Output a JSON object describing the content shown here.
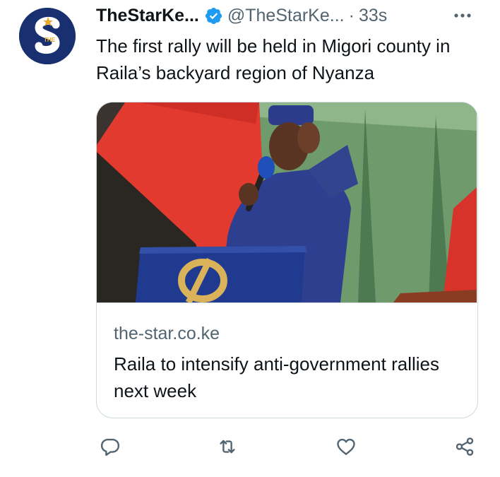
{
  "tweet": {
    "display_name": "TheStarKe...",
    "handle": "@TheStarKe...",
    "separator": "·",
    "timestamp": "33s",
    "text": "The first rally will be held in Migori county in Raila’s backyard region of Nyanza",
    "avatar_logo_text": "THE"
  },
  "card": {
    "domain": "the-star.co.ke",
    "title": "Raila to intensify anti-government rallies next week"
  },
  "icons": {
    "verified": "verified-badge-icon",
    "more": "more-options-icon",
    "reply": "reply-icon",
    "retweet": "retweet-icon",
    "like": "like-icon",
    "share": "share-icon"
  },
  "colors": {
    "verified_blue": "#1d9bf0",
    "avatar_navy": "#18306f",
    "secondary_text": "#536471",
    "border": "#cfd9de"
  }
}
